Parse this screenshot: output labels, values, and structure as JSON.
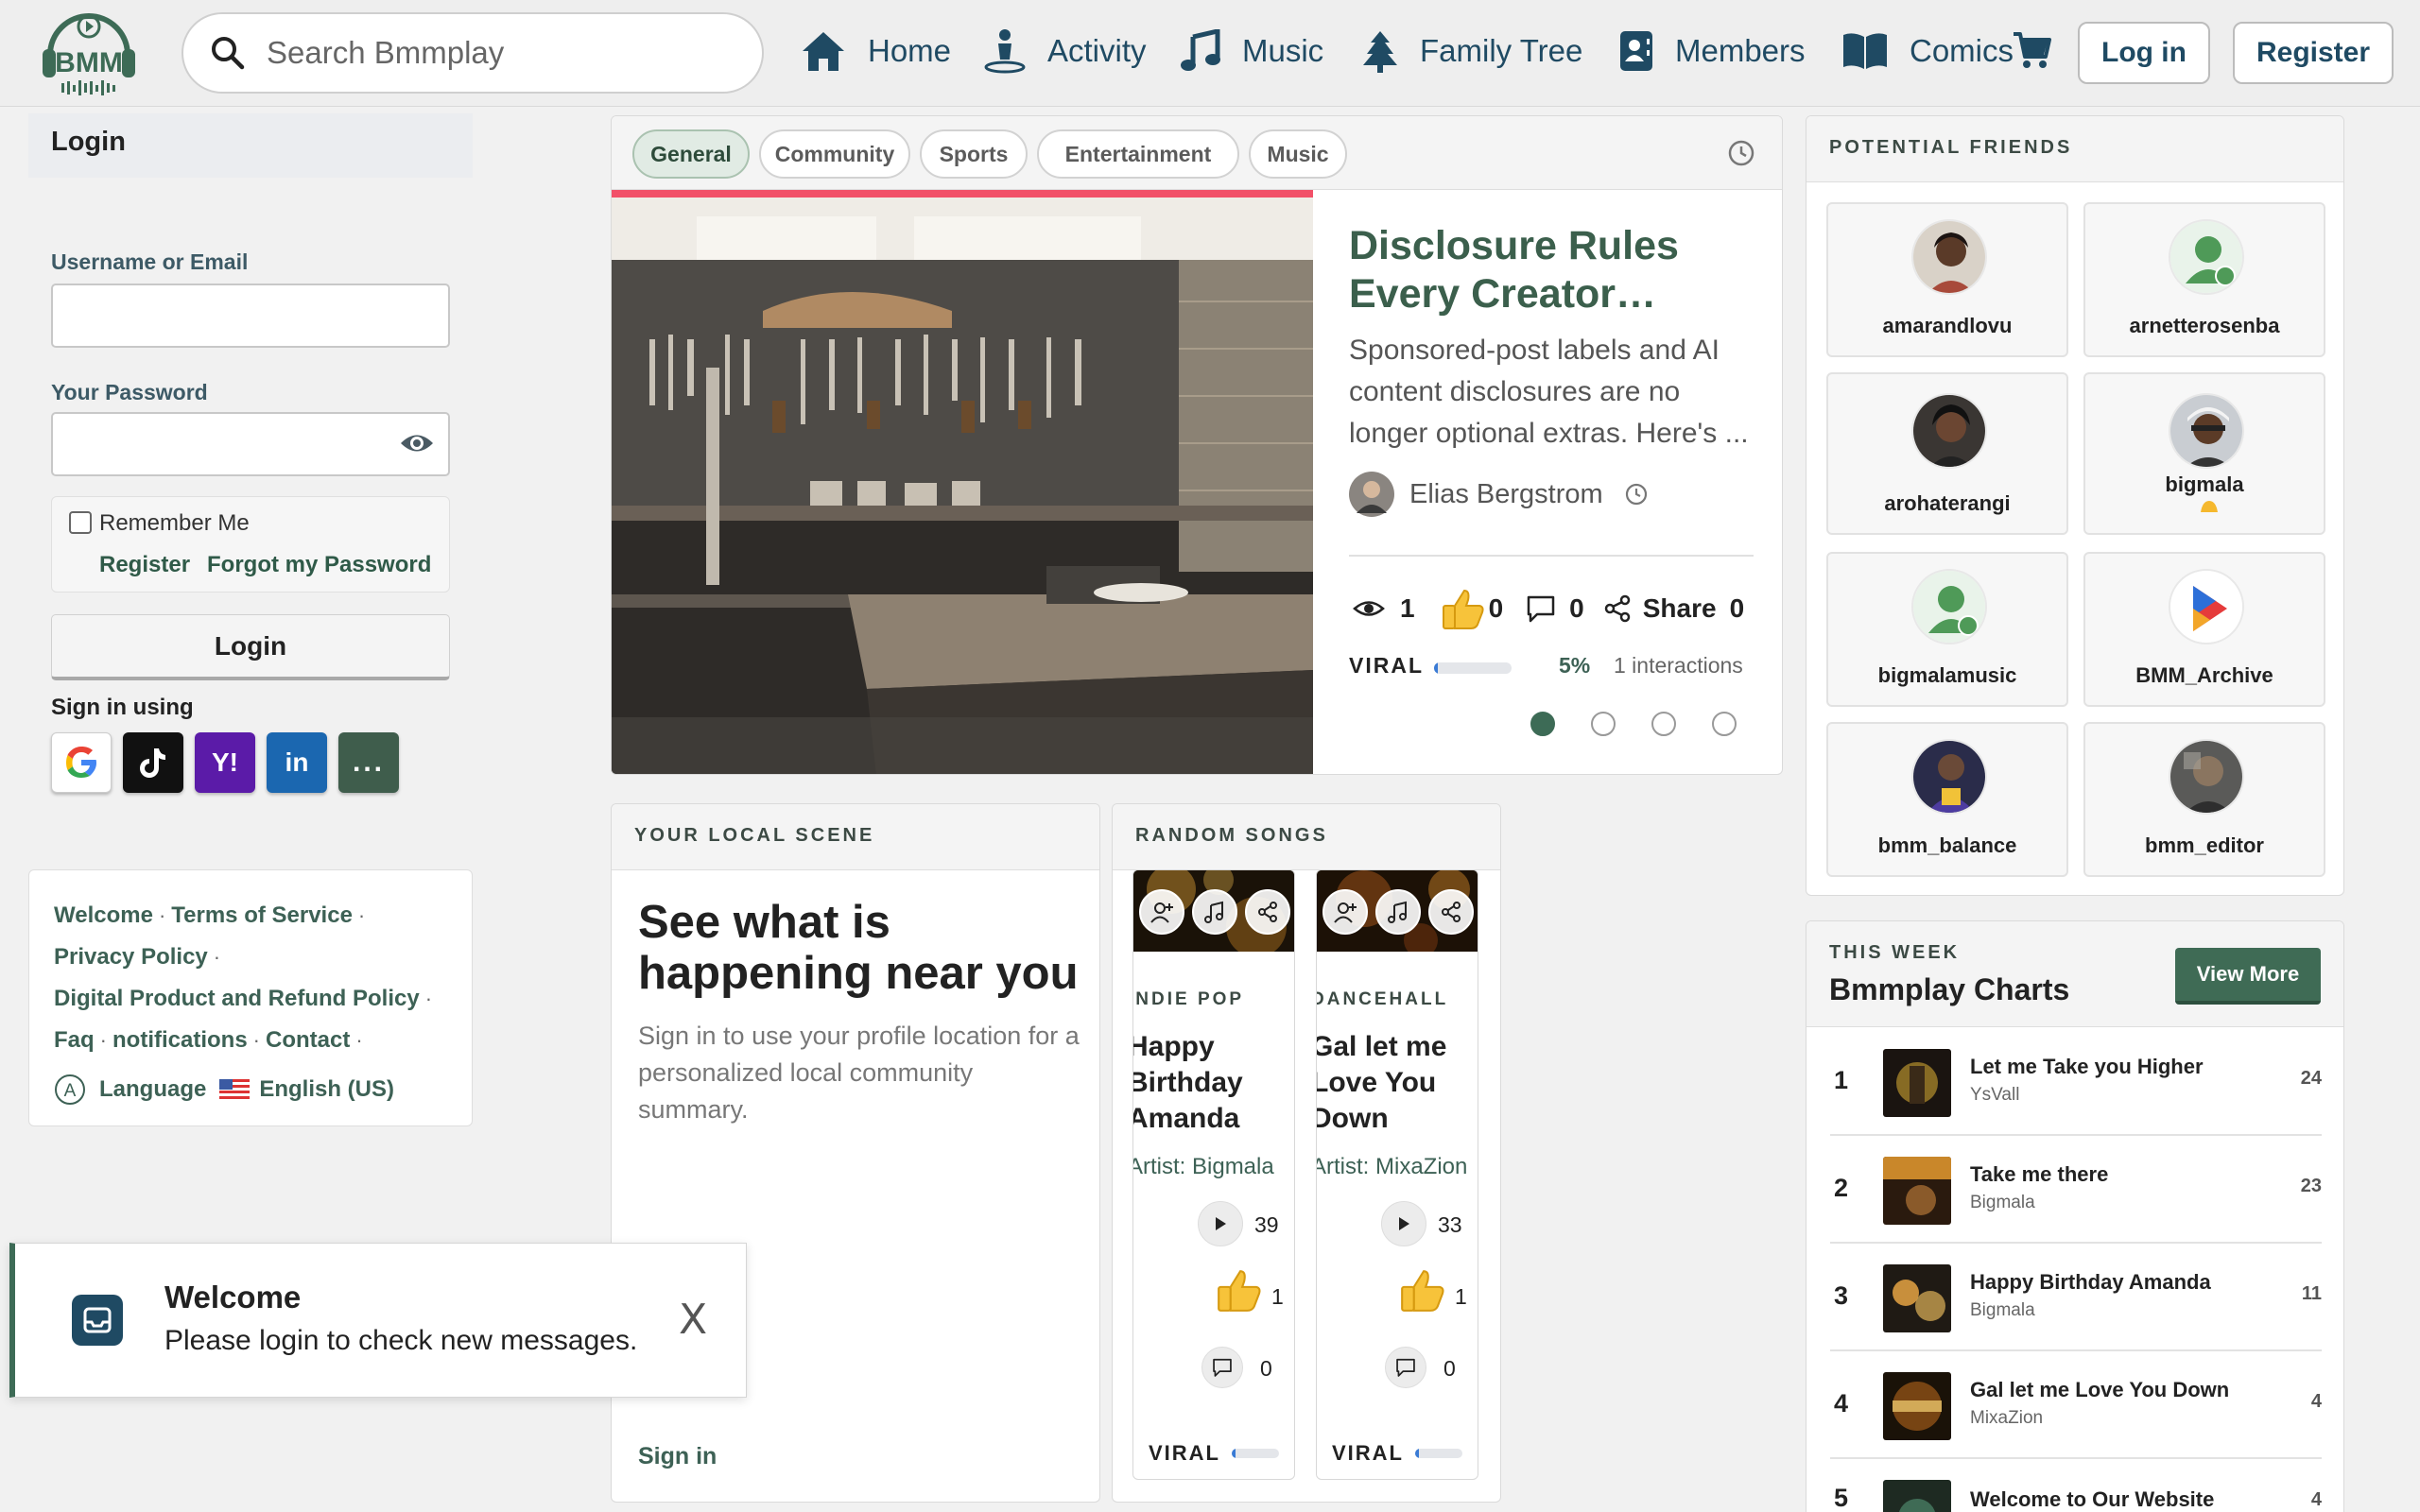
{
  "header": {
    "logo_text": "BMM",
    "search_placeholder": "Search Bmmplay",
    "nav": [
      {
        "label": "Home",
        "icon": "home-icon"
      },
      {
        "label": "Activity",
        "icon": "activity-icon"
      },
      {
        "label": "Music",
        "icon": "music-note-icon"
      },
      {
        "label": "Family Tree",
        "icon": "tree-icon"
      },
      {
        "label": "Members",
        "icon": "members-icon"
      },
      {
        "label": "Comics",
        "icon": "book-icon"
      }
    ],
    "cart_icon": "cart-icon",
    "login_label": "Log in",
    "register_label": "Register"
  },
  "login": {
    "title": "Login",
    "username_label": "Username or Email",
    "username_value": "",
    "password_label": "Your Password",
    "password_value": "",
    "remember_label": "Remember Me",
    "remember_checked": false,
    "register_link": "Register",
    "forgot_link": "Forgot my Password",
    "submit_label": "Login",
    "signin_using": "Sign in using",
    "providers": [
      {
        "name": "google",
        "label": "G",
        "color": "#ffffff"
      },
      {
        "name": "tiktok",
        "label": "♪",
        "color": "#111111"
      },
      {
        "name": "yahoo",
        "label": "Y!",
        "color": "#5b1ba8"
      },
      {
        "name": "linkedin",
        "label": "in",
        "color": "#1b67b0"
      },
      {
        "name": "more",
        "label": "...",
        "color": "#3f5d4c"
      }
    ]
  },
  "footer": {
    "links": [
      "Welcome",
      "Terms of Service",
      "Privacy Policy",
      "Digital Product and Refund Policy",
      "Faq",
      "notifications",
      "Contact"
    ],
    "language_label": "Language",
    "language_value": "English (US)"
  },
  "toast": {
    "title": "Welcome",
    "message": "Please login to check new messages.",
    "close": "X"
  },
  "featured": {
    "tabs": [
      "General",
      "Community",
      "Sports",
      "Entertainment",
      "Music"
    ],
    "active_tab": "General",
    "title": "Disclosure Rules Every Creator…",
    "description": "Sponsored-post labels and AI content disclosures are no longer optional extras. Here's ...",
    "author": "Elias Bergstrom",
    "views": "1",
    "likes": "0",
    "comments": "0",
    "share_label": "Share",
    "shares": "0",
    "viral_label": "VIRAL",
    "viral_percent_text": "5%",
    "viral_fraction": 0.05,
    "interactions": "1 interactions",
    "slides": 4,
    "active_slide": 0
  },
  "local_scene": {
    "caption": "YOUR LOCAL SCENE",
    "heading": "See what is happening near you",
    "text": "Sign in to use your profile location for a personalized local community summary.",
    "signin": "Sign in"
  },
  "random_songs": {
    "caption": "RANDOM SONGS",
    "songs": [
      {
        "genre": "INDIE POP",
        "title": "Happy Birthday Amanda",
        "artist": "Artist: Bigmala",
        "plays": "39",
        "likes": "1",
        "comments": "0",
        "viral_label": "VIRAL",
        "viral_fraction": 0.08
      },
      {
        "genre": "DANCEHALL",
        "title": "Gal let me Love You Down",
        "artist": "Artist: MixaZion",
        "plays": "33",
        "likes": "1",
        "comments": "0",
        "viral_label": "VIRAL",
        "viral_fraction": 0.08
      }
    ]
  },
  "friends": {
    "caption": "POTENTIAL FRIENDS",
    "people": [
      {
        "name": "amarandlovu",
        "avatar": "photo"
      },
      {
        "name": "arnetterosenba",
        "avatar": "default"
      },
      {
        "name": "arohaterangi",
        "avatar": "photo"
      },
      {
        "name": "bigmala",
        "avatar": "photo"
      },
      {
        "name": "bigmalamusic",
        "avatar": "default"
      },
      {
        "name": "BMM_Archive",
        "avatar": "logo"
      },
      {
        "name": "bmm_balance",
        "avatar": "photo"
      },
      {
        "name": "bmm_editor",
        "avatar": "photo"
      }
    ]
  },
  "charts": {
    "caption": "THIS WEEK",
    "title": "Bmmplay Charts",
    "view_more": "View More",
    "rows": [
      {
        "rank": "1",
        "title": "Let me Take you Higher",
        "artist": "YsVall",
        "plays": "24"
      },
      {
        "rank": "2",
        "title": "Take me there",
        "artist": "Bigmala",
        "plays": "23"
      },
      {
        "rank": "3",
        "title": "Happy Birthday Amanda",
        "artist": "Bigmala",
        "plays": "11"
      },
      {
        "rank": "4",
        "title": "Gal let me Love You Down",
        "artist": "MixaZion",
        "plays": "4"
      },
      {
        "rank": "5",
        "title": "Welcome to Our Website",
        "artist": "",
        "plays": "4"
      }
    ]
  },
  "colors": {
    "accent_green": "#3d6b56",
    "nav_blue": "#1f4a63",
    "highlight_red": "#f25068"
  }
}
